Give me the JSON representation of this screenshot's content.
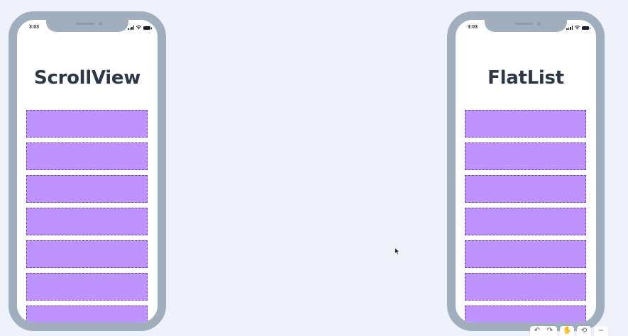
{
  "left_phone": {
    "status_time": "3:03",
    "title": "ScrollView",
    "item_count": 7
  },
  "right_phone": {
    "status_time": "3:03",
    "title": "FlatList",
    "item_count": 7
  },
  "colors": {
    "background": "#eff2fb",
    "phone_frame": "#a0aebe",
    "list_item_fill": "#be93fd",
    "list_item_border": "#6b3fa0",
    "title_text": "#2d3748"
  },
  "toolbar": {
    "undo_icon": "↶",
    "redo_icon": "↷",
    "hand_icon": "✋",
    "history_icon": "⟲",
    "zoom_out_icon": "−"
  }
}
